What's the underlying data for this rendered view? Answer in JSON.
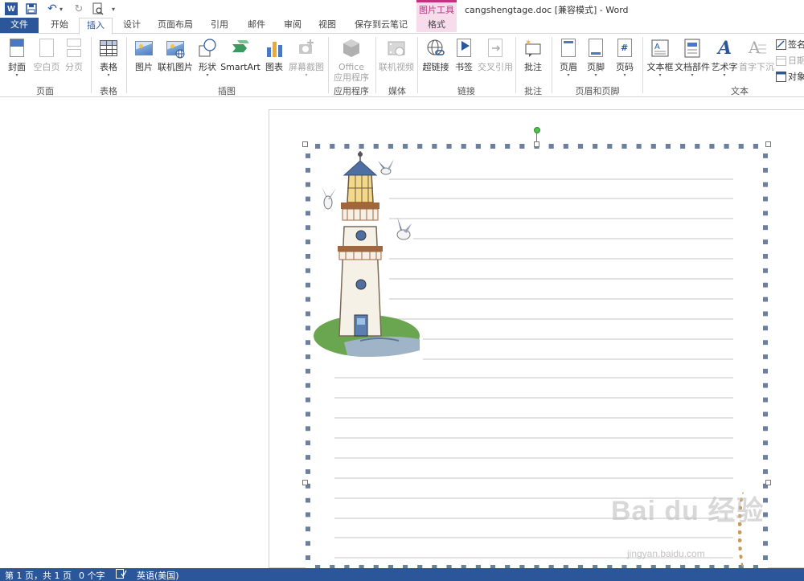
{
  "titlebar": {
    "context_tool": "图片工具",
    "document_title": "cangshengtage.doc [兼容模式] - Word"
  },
  "tabs": [
    {
      "label": "文件"
    },
    {
      "label": "开始"
    },
    {
      "label": "插入"
    },
    {
      "label": "设计"
    },
    {
      "label": "页面布局"
    },
    {
      "label": "引用"
    },
    {
      "label": "邮件"
    },
    {
      "label": "审阅"
    },
    {
      "label": "视图"
    },
    {
      "label": "保存到云笔记"
    },
    {
      "label": "格式"
    }
  ],
  "active_tab": "插入",
  "ribbon": {
    "pages": {
      "cover": "封面",
      "blank": "空白页",
      "break": "分页",
      "group": "页面"
    },
    "tables": {
      "table": "表格",
      "group": "表格"
    },
    "illustrations": {
      "picture": "图片",
      "online_picture": "联机图片",
      "shapes": "形状",
      "smartart": "SmartArt",
      "chart": "图表",
      "screenshot": "屏幕截图",
      "group": "插图"
    },
    "apps": {
      "office": "Office",
      "office2": "应用程序",
      "group": "应用程序"
    },
    "media": {
      "online_video": "联机视频",
      "group": "媒体"
    },
    "links": {
      "hyperlink": "超链接",
      "bookmark": "书签",
      "cross_ref": "交叉引用",
      "group": "链接"
    },
    "comments": {
      "comment": "批注",
      "group": "批注"
    },
    "header_footer": {
      "header": "页眉",
      "footer": "页脚",
      "page_number": "页码",
      "group": "页眉和页脚"
    },
    "text": {
      "text_box": "文本框",
      "quick_parts": "文档部件",
      "wordart": "艺术字",
      "drop_cap": "首字下沉",
      "signature": "签名",
      "date": "日期",
      "object": "对象",
      "group": "文本"
    }
  },
  "watermark": {
    "brand": "Bai du 经验",
    "url": "jingyan.baidu.com"
  },
  "status": {
    "page": "第 1 页，共 1 页",
    "words": "0 个字",
    "language": "英语(美国)"
  },
  "colors": {
    "accent": "#2b579a",
    "context_tab": "#c6317f",
    "frame": "#6d7f9e"
  }
}
